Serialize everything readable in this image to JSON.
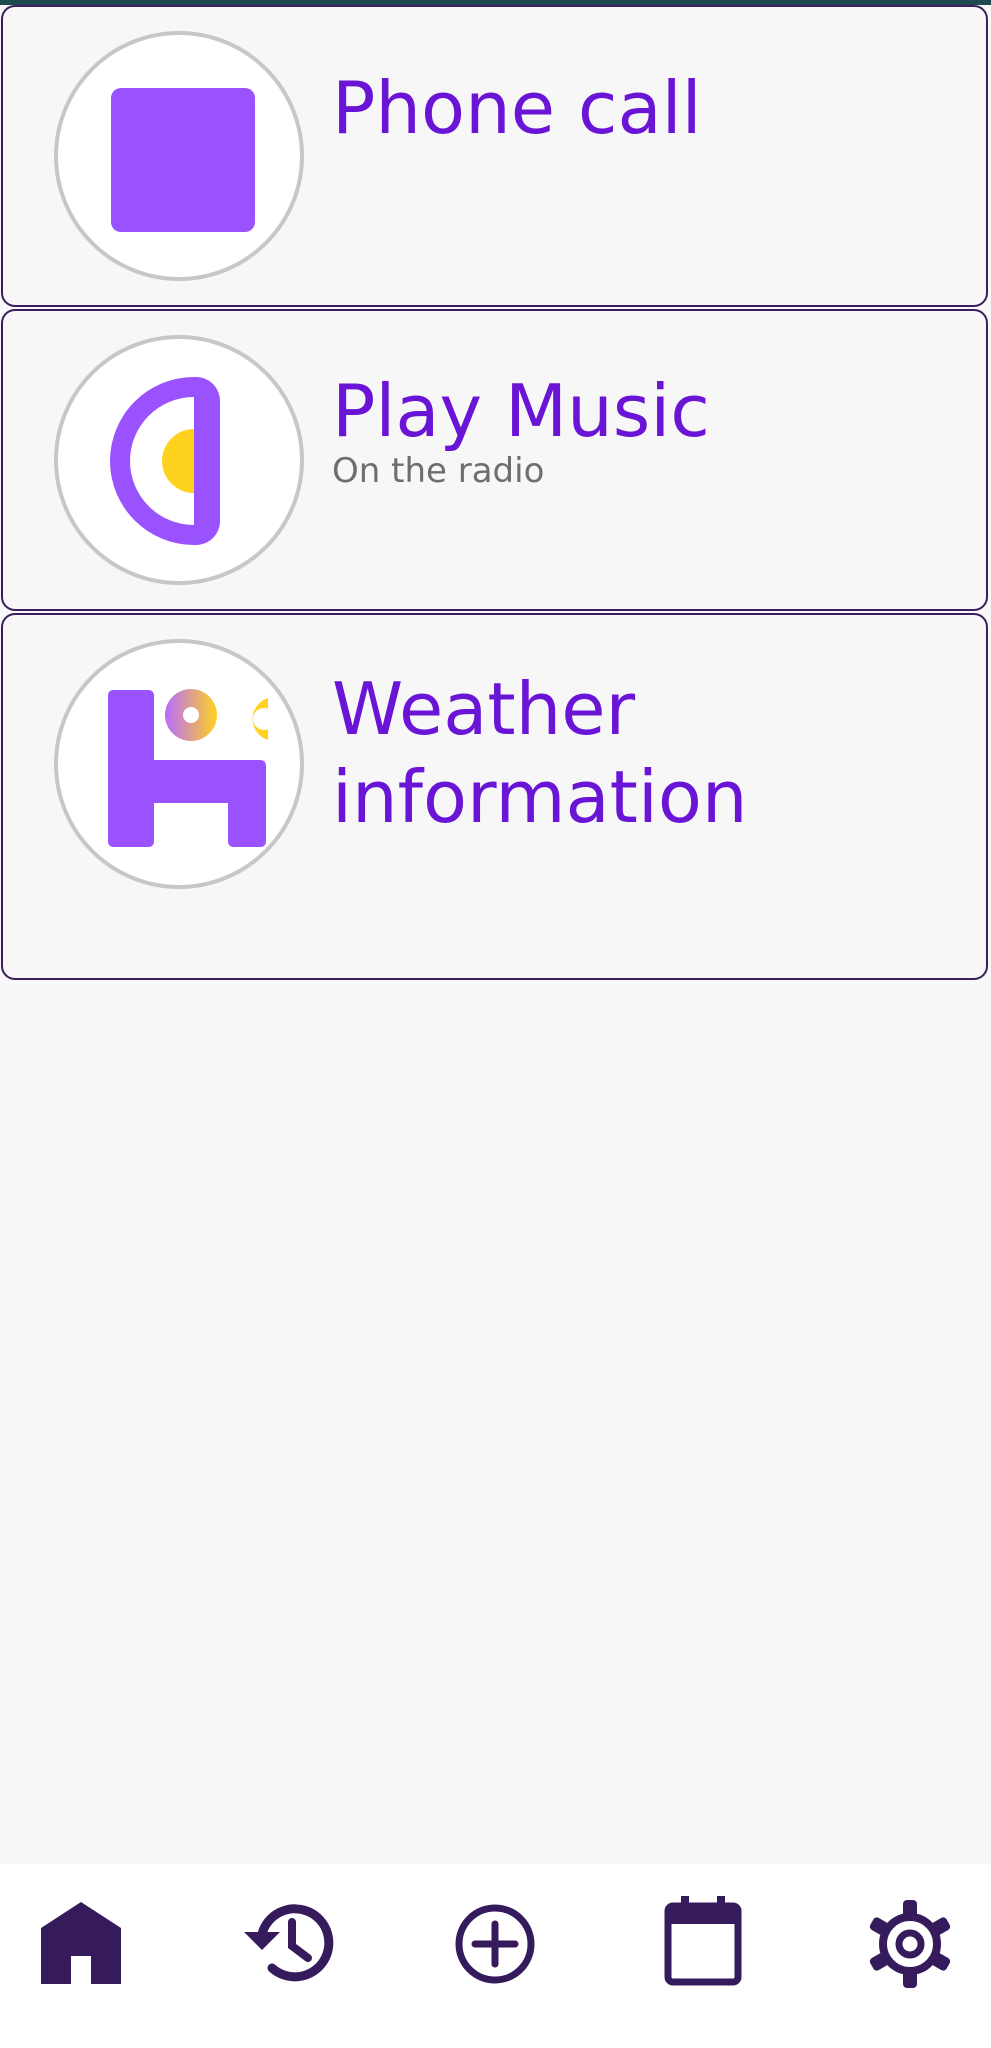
{
  "cards": [
    {
      "title": "Phone call",
      "subtitle": "",
      "icon": "phone-call-icon"
    },
    {
      "title": "Play Music",
      "subtitle": "On the radio",
      "icon": "play-music-icon"
    },
    {
      "title_line1": "Weather",
      "title_line2": "information",
      "subtitle": "",
      "icon": "weather-icon"
    }
  ],
  "bottom_nav": [
    {
      "name": "home",
      "icon": "home-icon"
    },
    {
      "name": "history",
      "icon": "history-icon"
    },
    {
      "name": "add",
      "icon": "add-circle-icon"
    },
    {
      "name": "calendar",
      "icon": "calendar-icon"
    },
    {
      "name": "settings",
      "icon": "settings-icon"
    }
  ],
  "colors": {
    "accent_text": "#6a14d6",
    "icon_purple": "#9a52ff",
    "icon_yellow": "#ffd21f",
    "nav_dark": "#351a5c"
  }
}
